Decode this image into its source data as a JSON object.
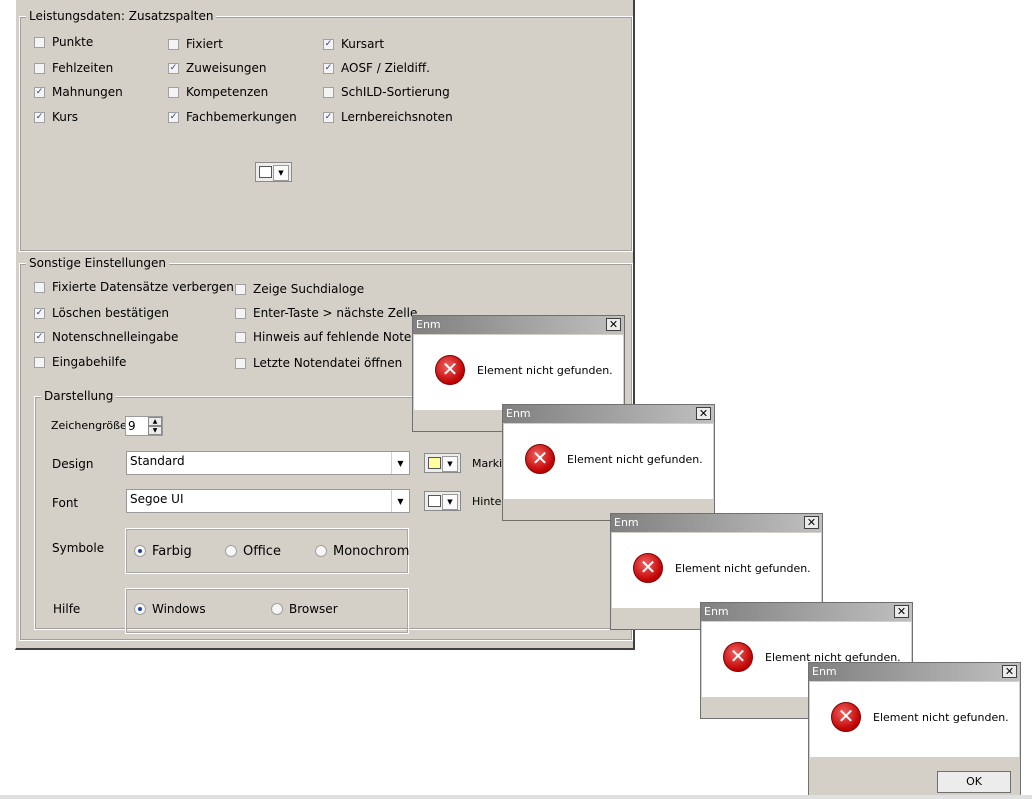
{
  "leistungsdaten": {
    "group_title": "Leistungsdaten: Zusatzspalten",
    "checkboxes": [
      {
        "label": "Punkte",
        "checked": false
      },
      {
        "label": "Fehlzeiten",
        "checked": false
      },
      {
        "label": "Mahnungen",
        "checked": true
      },
      {
        "label": "Kurs",
        "checked": true
      },
      {
        "label": "Fixiert",
        "checked": false
      },
      {
        "label": "Zuweisungen",
        "checked": true
      },
      {
        "label": "Kompetenzen",
        "checked": false
      },
      {
        "label": "Fachbemerkungen",
        "checked": true
      },
      {
        "label": "Kursart",
        "checked": true
      },
      {
        "label": "AOSF / Zieldiff.",
        "checked": true
      },
      {
        "label": "SchILD-Sortierung",
        "checked": false
      },
      {
        "label": "Lernbereichsnoten",
        "checked": true
      }
    ]
  },
  "sonstige": {
    "group_title": "Sonstige Einstellungen",
    "checkboxes": [
      {
        "label": "Fixierte Datensätze verbergen",
        "checked": false
      },
      {
        "label": "Löschen bestätigen",
        "checked": true
      },
      {
        "label": "Notenschnelleingabe",
        "checked": true
      },
      {
        "label": "Eingabehilfe",
        "checked": false
      },
      {
        "label": "Zeige Suchdialoge",
        "checked": false
      },
      {
        "label": "Enter-Taste > nächste Zelle",
        "checked": false
      },
      {
        "label": "Hinweis auf fehlende Noten",
        "checked": false
      },
      {
        "label": "Letzte Notendatei öffnen",
        "checked": false
      }
    ]
  },
  "darstellung": {
    "group_title": "Darstellung",
    "zeichengroesse_label": "Zeichengröße",
    "zeichengroesse_value": "9",
    "design_label": "Design",
    "design_value": "Standard",
    "font_label": "Font",
    "font_value": "Segoe UI",
    "markie_label": "Markie",
    "hinter_label": "Hinter",
    "markie_color": "#ffffa0",
    "hinter_color": "#ffffff",
    "symbole_label": "Symbole",
    "symbole_options": [
      {
        "label": "Farbig",
        "selected": true
      },
      {
        "label": "Office",
        "selected": false
      },
      {
        "label": "Monochrom",
        "selected": false
      }
    ],
    "hilfe_label": "Hilfe",
    "hilfe_options": [
      {
        "label": "Windows",
        "selected": true
      },
      {
        "label": "Browser",
        "selected": false
      }
    ]
  },
  "leistungs_color": "#ffffff",
  "dialogs": [
    {
      "title": "Enm",
      "message": "Element nicht gefunden.",
      "close": "✕"
    },
    {
      "title": "Enm",
      "message": "Element nicht gefunden.",
      "close": "✕"
    },
    {
      "title": "Enm",
      "message": "Element nicht gefunden.",
      "close": "✕"
    },
    {
      "title": "Enm",
      "message": "Element nicht gefunden.",
      "close": "✕"
    },
    {
      "title": "Enm",
      "message": "Element nicht gefunden.",
      "close": "✕"
    }
  ],
  "ok_label": "OK",
  "icons": {
    "checkmark": "✓",
    "dropdown": "▼",
    "spin_up": "▲",
    "spin_down": "▼",
    "error": "✕"
  }
}
